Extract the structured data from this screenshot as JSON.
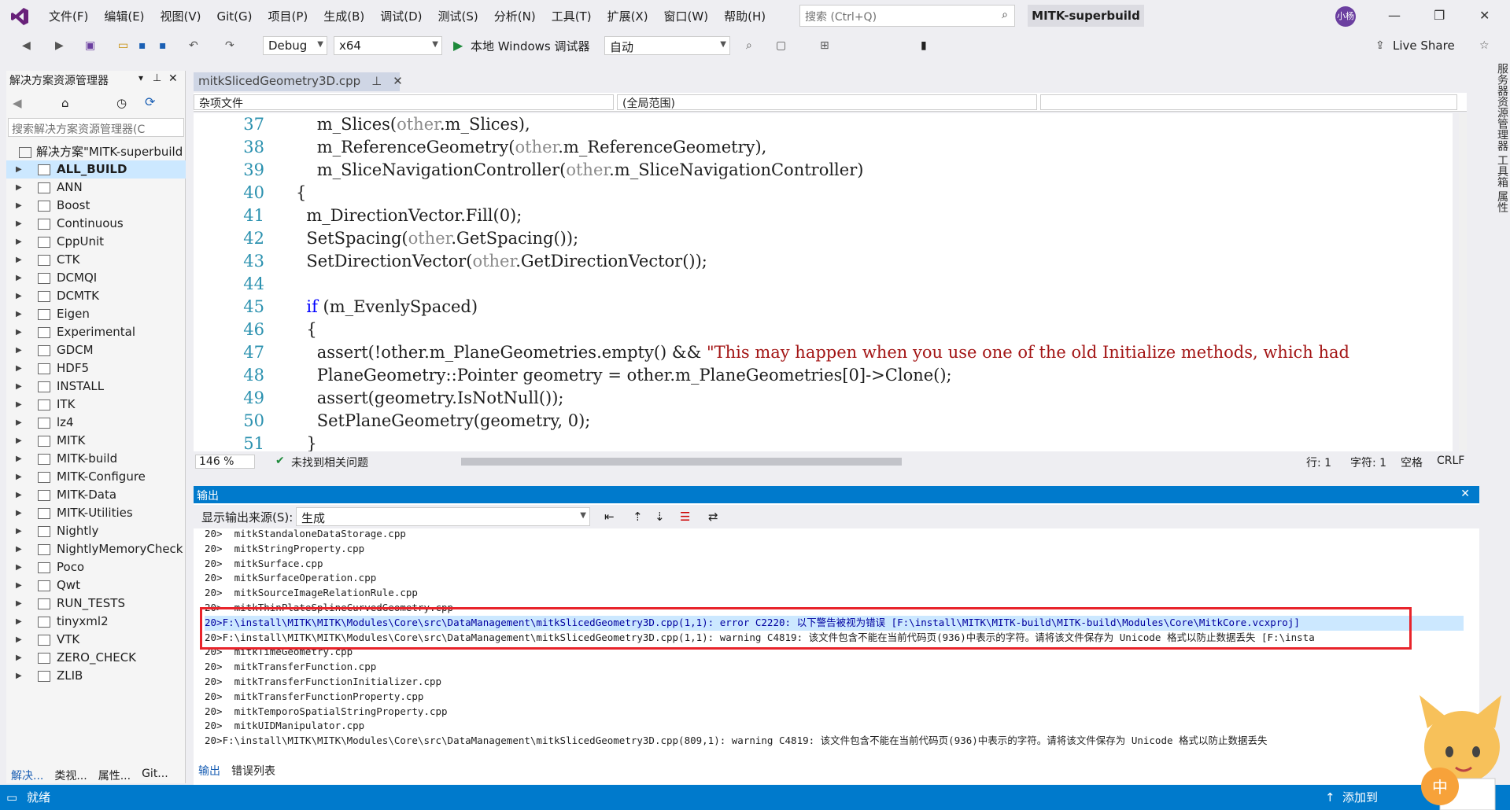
{
  "menu": [
    "文件(F)",
    "编辑(E)",
    "视图(V)",
    "Git(G)",
    "项目(P)",
    "生成(B)",
    "调试(D)",
    "测试(S)",
    "分析(N)",
    "工具(T)",
    "扩展(X)",
    "窗口(W)",
    "帮助(H)"
  ],
  "search": {
    "placeholder": "搜索 (Ctrl+Q)"
  },
  "project_title": "MITK-superbuild",
  "avatar_text": "小杨",
  "toolbar": {
    "config": "Debug",
    "platform": "x64",
    "debugger": "本地 Windows 调试器",
    "mode": "自动",
    "live_share": "Live Share"
  },
  "solution_explorer": {
    "title": "解决方案资源管理器",
    "search_placeholder": "搜索解决方案资源管理器(C",
    "root": "解决方案\"MITK-superbuild",
    "items": [
      "ALL_BUILD",
      "ANN",
      "Boost",
      "Continuous",
      "CppUnit",
      "CTK",
      "DCMQI",
      "DCMTK",
      "Eigen",
      "Experimental",
      "GDCM",
      "HDF5",
      "INSTALL",
      "ITK",
      "lz4",
      "MITK",
      "MITK-build",
      "MITK-Configure",
      "MITK-Data",
      "MITK-Utilities",
      "Nightly",
      "NightlyMemoryCheck",
      "Poco",
      "Qwt",
      "RUN_TESTS",
      "tinyxml2",
      "VTK",
      "ZERO_CHECK",
      "ZLIB"
    ],
    "selected": "ALL_BUILD",
    "tabs": [
      "解决...",
      "类视...",
      "属性...",
      "Git..."
    ]
  },
  "editor": {
    "tab": "mitkSlicedGeometry3D.cpp",
    "nav_file": "杂项文件",
    "nav_scope": "(全局范围)",
    "lines": [
      {
        "n": "37",
        "t": "    m_Slices(other.m_Slices),"
      },
      {
        "n": "38",
        "t": "    m_ReferenceGeometry(other.m_ReferenceGeometry),"
      },
      {
        "n": "39",
        "t": "    m_SliceNavigationController(other.m_SliceNavigationController)"
      },
      {
        "n": "40",
        "t": "{"
      },
      {
        "n": "41",
        "t": "  m_DirectionVector.Fill(0);"
      },
      {
        "n": "42",
        "t": "  SetSpacing(other.GetSpacing());"
      },
      {
        "n": "43",
        "t": "  SetDirectionVector(other.GetDirectionVector());"
      },
      {
        "n": "44",
        "t": ""
      },
      {
        "n": "45",
        "t": "  if (m_EvenlySpaced)"
      },
      {
        "n": "46",
        "t": "  {"
      },
      {
        "n": "47",
        "t": "    assert(!other.m_PlaneGeometries.empty() && \"This may happen when you use one of the old Initialize methods, which had"
      },
      {
        "n": "48",
        "t": "    PlaneGeometry::Pointer geometry = other.m_PlaneGeometries[0]->Clone();"
      },
      {
        "n": "49",
        "t": "    assert(geometry.IsNotNull());"
      },
      {
        "n": "50",
        "t": "    SetPlaneGeometry(geometry, 0);"
      },
      {
        "n": "51",
        "t": "  }"
      }
    ],
    "zoom": "146 %",
    "issues": "未找到相关问题",
    "row": "行: 1",
    "col": "字符: 1",
    "ws": "空格",
    "eol": "CRLF"
  },
  "output": {
    "title": "输出",
    "source_label": "显示输出来源(S):",
    "source_value": "生成",
    "lines": [
      "20>  mitkStandaloneDataStorage.cpp",
      "20>  mitkStringProperty.cpp",
      "20>  mitkSurface.cpp",
      "20>  mitkSurfaceOperation.cpp",
      "20>  mitkSourceImageRelationRule.cpp",
      "20>  mitkThinPlateSplineCurvedGeometry.cpp",
      "20>F:\\install\\MITK\\MITK\\Modules\\Core\\src\\DataManagement\\mitkSlicedGeometry3D.cpp(1,1): error C2220: 以下警告被视为错误 [F:\\install\\MITK\\MITK-build\\MITK-build\\Modules\\Core\\MitkCore.vcxproj]",
      "20>F:\\install\\MITK\\MITK\\Modules\\Core\\src\\DataManagement\\mitkSlicedGeometry3D.cpp(1,1): warning C4819: 该文件包含不能在当前代码页(936)中表示的字符。请将该文件保存为 Unicode 格式以防止数据丢失 [F:\\insta",
      "20>  mitkTimeGeometry.cpp",
      "20>  mitkTransferFunction.cpp",
      "20>  mitkTransferFunctionInitializer.cpp",
      "20>  mitkTransferFunctionProperty.cpp",
      "20>  mitkTemporoSpatialStringProperty.cpp",
      "20>  mitkUIDManipulator.cpp",
      "20>F:\\install\\MITK\\MITK\\Modules\\Core\\src\\DataManagement\\mitkSlicedGeometry3D.cpp(809,1): warning C4819: 该文件包含不能在当前代码页(936)中表示的字符。请将该文件保存为 Unicode 格式以防止数据丢失"
    ],
    "tabs": [
      "输出",
      "错误列表"
    ]
  },
  "right_strip": "服务器资源管理器  工具箱  属性",
  "status": {
    "ready": "就绪",
    "add": "添加到"
  },
  "mascot_badge": "中",
  "colors": {
    "accent": "#007acc",
    "error_box": "#e8242b"
  }
}
